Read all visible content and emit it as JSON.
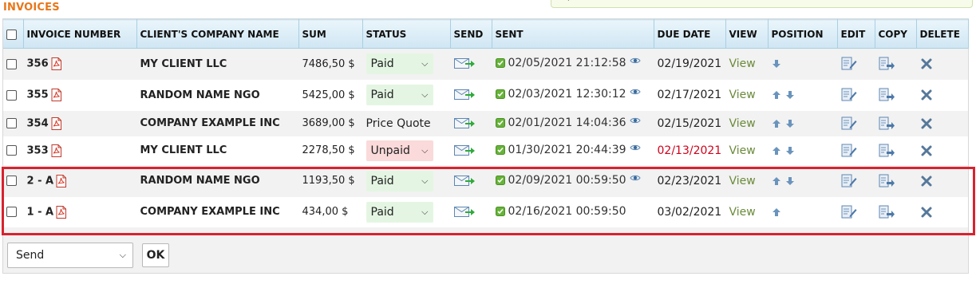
{
  "page": {
    "title": "INVOICES"
  },
  "table": {
    "headers": [
      "INVOICE NUMBER",
      "CLIENT'S COMPANY NAME",
      "SUM",
      "STATUS",
      "SEND",
      "SENT",
      "DUE DATE",
      "VIEW",
      "POSITION",
      "EDIT",
      "COPY",
      "DELETE"
    ],
    "rows": [
      {
        "number": "356",
        "client": "MY CLIENT LLC",
        "sum": "7486,50 $",
        "status": "Paid",
        "status_type": "select-paid",
        "sent": "02/05/2021 21:12:58",
        "viewed": true,
        "due": "02/19/2021",
        "due_overdue": false,
        "view": "View",
        "arrows": [
          "down"
        ]
      },
      {
        "number": "355",
        "client": "RANDOM NAME NGO",
        "sum": "5425,00 $",
        "status": "Paid",
        "status_type": "select-paid",
        "sent": "02/03/2021 12:30:12",
        "viewed": true,
        "due": "02/17/2021",
        "due_overdue": false,
        "view": "View",
        "arrows": [
          "up",
          "down"
        ]
      },
      {
        "number": "354",
        "client": "COMPANY EXAMPLE INC",
        "sum": "3689,00 $",
        "status": "Price Quote",
        "status_type": "text",
        "sent": "02/01/2021 14:04:36",
        "viewed": true,
        "due": "02/15/2021",
        "due_overdue": false,
        "view": "View",
        "arrows": [
          "up",
          "down"
        ]
      },
      {
        "number": "353",
        "client": "MY CLIENT LLC",
        "sum": "2278,50 $",
        "status": "Unpaid",
        "status_type": "select-unpaid",
        "sent": "01/30/2021 20:44:39",
        "viewed": true,
        "due": "02/13/2021",
        "due_overdue": true,
        "view": "View",
        "arrows": [
          "up",
          "down"
        ]
      },
      {
        "number": "2 - A",
        "client": "RANDOM NAME NGO",
        "sum": "1193,50 $",
        "status": "Paid",
        "status_type": "select-paid",
        "sent": "02/09/2021 00:59:50",
        "viewed": true,
        "due": "02/23/2021",
        "due_overdue": false,
        "view": "View",
        "arrows": [
          "up",
          "down"
        ]
      },
      {
        "number": "1 - A",
        "client": "COMPANY EXAMPLE INC",
        "sum": "434,00 $",
        "status": "Paid",
        "status_type": "select-paid",
        "sent": "02/16/2021 00:59:50",
        "viewed": false,
        "due": "03/02/2021",
        "due_overdue": false,
        "view": "View",
        "arrows": [
          "up"
        ]
      }
    ]
  },
  "footer": {
    "action_select": "Send",
    "ok_label": "OK"
  },
  "colors": {
    "title": "#e8771a",
    "header_bg": "#cfe6f3",
    "paid_bg": "#e4f6e3",
    "unpaid_bg": "#fadada",
    "overdue": "#d0021b",
    "view_link": "#6a8a3a",
    "highlight": "#d7232f",
    "icon_blue": "#5d87b3"
  },
  "icons": {
    "pdf": "pdf-icon",
    "send": "envelope-arrow-icon",
    "sent_check": "check-icon",
    "viewed": "eye-icon",
    "edit": "edit-icon",
    "copy": "copy-icon",
    "delete": "close-icon"
  }
}
